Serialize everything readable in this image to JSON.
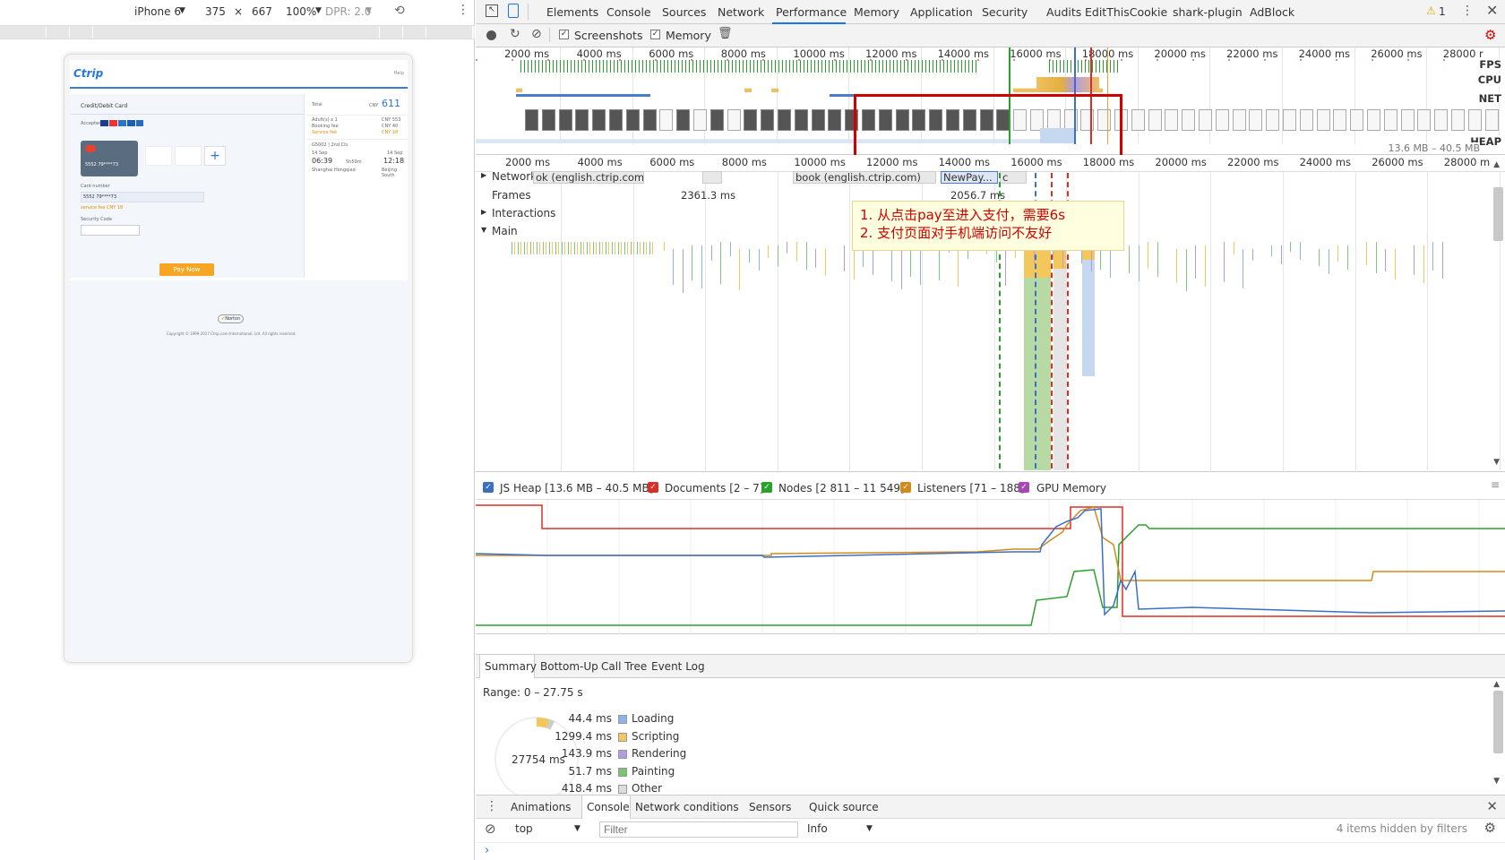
{
  "device_toolbar": {
    "device": "iPhone 6",
    "width": "375",
    "times": "×",
    "height": "667",
    "zoom": "100%",
    "dpr": "DPR: 2.0"
  },
  "page": {
    "logo": "Ctrip",
    "help": "Help",
    "section_title": "Credit/Debit Card",
    "accepted": "Accepted:",
    "card_number_label": "Card number",
    "card_number_value": "5552 79****73",
    "card_masked": "5552 79****73",
    "service_fee": "service fee CNY 18",
    "security_label": "Security Code",
    "pay_button": "Pay Now",
    "total_label": "Total",
    "total_currency": "CNY",
    "total_value": "611",
    "adults": "Adult(s) x 1",
    "adults_price": "CNY 553",
    "booking_fee": "Booking fee",
    "booking_fee_price": "CNY 40",
    "service_fee_label": "Service fee",
    "service_fee_price": "CNY 18",
    "train": "G5002 | 2nd Cls.",
    "dep_date": "14 Sep",
    "arr_date": "14 Sep",
    "dep_time": "06:39",
    "duration": "5h59m",
    "arr_time": "12:18",
    "from": "Shanghai Hongqiao",
    "to": "Beijing South",
    "norton": "Norton",
    "copyright": "Copyright © 1999-2017 Ctrip.com International, Ltd. All rights reserved."
  },
  "devtools": {
    "tabs": [
      "Elements",
      "Console",
      "Sources",
      "Network",
      "Performance",
      "Memory",
      "Application",
      "Security",
      "Audits",
      "EditThisCookie",
      "shark-plugin",
      "AdBlock"
    ],
    "active_tab": "Performance",
    "warning_count": "1",
    "toolbar": {
      "screenshots": "Screenshots",
      "memory": "Memory"
    },
    "overview_ticks": [
      "2000 ms",
      "4000 ms",
      "6000 ms",
      "8000 ms",
      "10000 ms",
      "12000 ms",
      "14000 ms",
      "16000 ms",
      "18000 ms",
      "20000 ms",
      "22000 ms",
      "24000 ms",
      "26000 ms",
      "28000 r"
    ],
    "flame_ticks": [
      "2000 ms",
      "4000 ms",
      "6000 ms",
      "8000 ms",
      "10000 ms",
      "12000 ms",
      "14000 ms",
      "16000 ms",
      "18000 ms",
      "20000 ms",
      "22000 ms",
      "24000 ms",
      "26000 ms",
      "28000 m"
    ],
    "side_labels": {
      "fps": "FPS",
      "cpu": "CPU",
      "net": "NET",
      "heap": "HEAP",
      "heap_range": "13.6 MB – 40.5 MB"
    },
    "tracks": {
      "network": "Network",
      "frames": "Frames",
      "interactions": "Interactions",
      "main": "Main"
    },
    "network_items": [
      "ok (english.ctrip.com)",
      "book (english.ctrip.com)",
      "NewPay...",
      "c"
    ],
    "frame_values": [
      "2361.3 ms",
      "2056.7 ms"
    ],
    "annotation": [
      "1. 从点击pay至进入支付，需要6s",
      "2. 支付页面对手机端访问不友好"
    ],
    "memory_legend": [
      {
        "label": "JS Heap [13.6 MB – 40.5 MB]",
        "color": "#3b6fc4"
      },
      {
        "label": "Documents [2 – 7]",
        "color": "#d93025"
      },
      {
        "label": "Nodes [2 811 – 11 549]",
        "color": "#2ca02c"
      },
      {
        "label": "Listeners [71 – 188]",
        "color": "#d28a1c"
      },
      {
        "label": "GPU Memory",
        "color": "#a846b4"
      }
    ],
    "summary_tabs": [
      "Summary",
      "Bottom-Up",
      "Call Tree",
      "Event Log"
    ],
    "range": "Range: 0 – 27.75 s",
    "total_ms": "27754 ms",
    "summary_rows": [
      {
        "value": "44.4 ms",
        "label": "Loading",
        "color": "#8cb4e6"
      },
      {
        "value": "1299.4 ms",
        "label": "Scripting",
        "color": "#f2c75c"
      },
      {
        "value": "143.9 ms",
        "label": "Rendering",
        "color": "#af9ee3"
      },
      {
        "value": "51.7 ms",
        "label": "Painting",
        "color": "#79c46e"
      },
      {
        "value": "418.4 ms",
        "label": "Other",
        "color": "#dddddd"
      }
    ],
    "drawer_tabs": [
      "Animations",
      "Console",
      "Network conditions",
      "Sensors",
      "Quick source"
    ],
    "console": {
      "context": "top",
      "filter_placeholder": "Filter",
      "level": "Info",
      "hidden": "4 items hidden by filters",
      "prompt": "›"
    }
  }
}
